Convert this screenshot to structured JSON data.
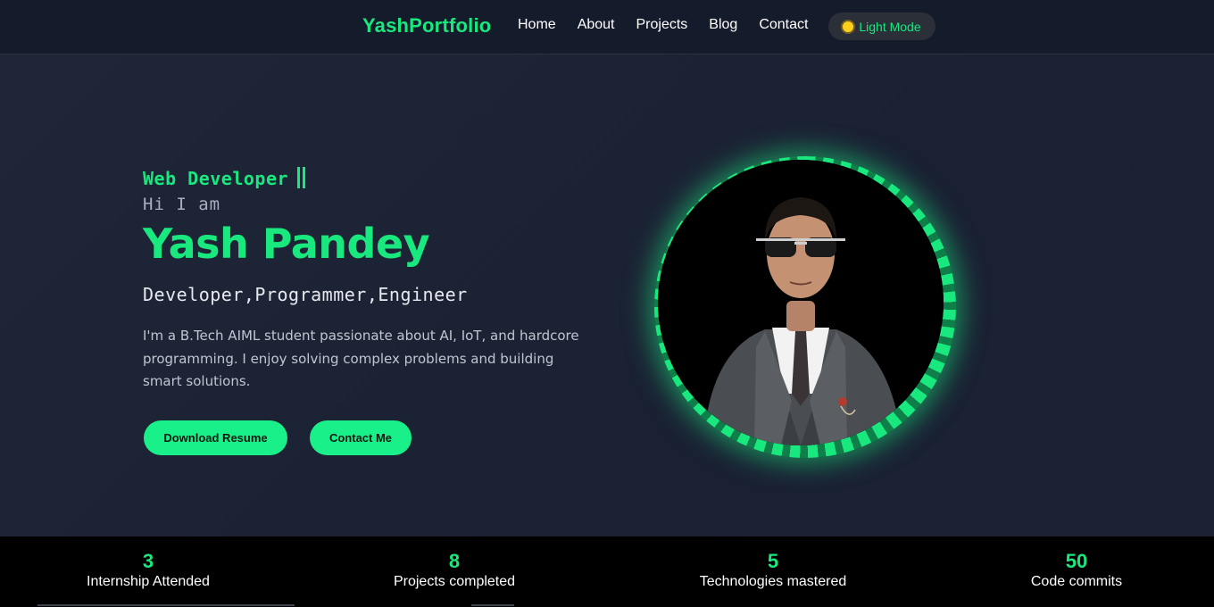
{
  "nav": {
    "brand": "YashPortfolio",
    "links": [
      "Home",
      "About",
      "Projects",
      "Blog",
      "Contact"
    ],
    "mode_toggle": "Light Mode"
  },
  "hero": {
    "role": "Web Developer",
    "greeting": "Hi I am",
    "name": "Yash Pandey",
    "titles": "Developer,Programmer,Engineer",
    "bio": "I'm a B.Tech AIML student passionate about AI, IoT, and hardcore programming. I enjoy solving complex problems and building smart solutions.",
    "buttons": {
      "resume": "Download Resume",
      "contact": "Contact Me"
    }
  },
  "stats": [
    {
      "value": "3",
      "label": "Internship Attended"
    },
    {
      "value": "8",
      "label": "Projects completed"
    },
    {
      "value": "5",
      "label": "Technologies mastered"
    },
    {
      "value": "50",
      "label": "Code commits"
    }
  ],
  "colors": {
    "accent": "#19e87e",
    "background": "#1b2233",
    "navbar": "#141b2b",
    "stats_bar": "#000000"
  },
  "icons": {
    "mode_toggle": "sun-icon"
  }
}
